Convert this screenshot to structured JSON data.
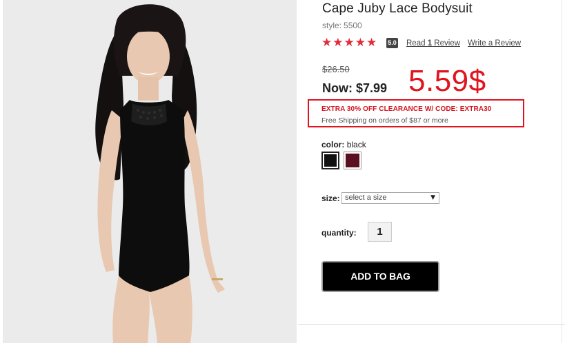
{
  "product": {
    "title": "Cape Juby Lace Bodysuit",
    "style_label": "style:",
    "style_number": "5500",
    "rating": "5.0",
    "stars": 5,
    "read_reviews": {
      "prefix": "Read ",
      "count": "1",
      "suffix": " Review"
    },
    "write_review": "Write a Review"
  },
  "pricing": {
    "original_price": "$26.50",
    "now_label": "Now:",
    "now_price": "$7.99",
    "annotation": "5.59$",
    "promo": "EXTRA 30% OFF CLEARANCE W/ CODE: EXTRA30",
    "shipping": "Free Shipping on orders of $87 or more"
  },
  "options": {
    "color_label": "color:",
    "color_value": "black",
    "swatches": [
      {
        "name": "black",
        "hex": "#111111"
      },
      {
        "name": "burgundy",
        "hex": "#5a0f22"
      }
    ],
    "size_label": "size:",
    "size_placeholder": "select a size",
    "quantity_label": "quantity:",
    "quantity": "1"
  },
  "actions": {
    "add_to_bag": "ADD TO BAG"
  },
  "colors": {
    "star": "#e22c3a",
    "annotation_red": "#e0141f",
    "button_bg": "#000000"
  }
}
